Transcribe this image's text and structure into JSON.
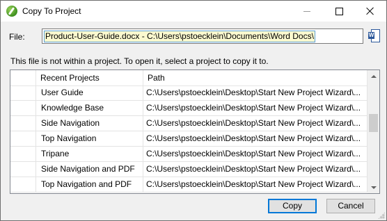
{
  "window": {
    "title": "Copy To Project",
    "controls": {
      "minimize": "minimize",
      "maximize": "maximize",
      "close": "close"
    }
  },
  "file": {
    "label": "File:",
    "value": "Product-User-Guide.docx - C:\\Users\\pstoecklein\\Documents\\Word Docs\\",
    "icon": "word-document-icon"
  },
  "notice": "This file is not within a project. To open it, select a project to copy it to.",
  "table": {
    "columns": [
      "",
      "Recent Projects",
      "Path"
    ],
    "rows": [
      {
        "name": "User Guide",
        "path": "C:\\Users\\pstoecklein\\Desktop\\Start New Project Wizard\\..."
      },
      {
        "name": "Knowledge Base",
        "path": "C:\\Users\\pstoecklein\\Desktop\\Start New Project Wizard\\..."
      },
      {
        "name": "Side Navigation",
        "path": "C:\\Users\\pstoecklein\\Desktop\\Start New Project Wizard\\..."
      },
      {
        "name": "Top Navigation",
        "path": "C:\\Users\\pstoecklein\\Desktop\\Start New Project Wizard\\..."
      },
      {
        "name": "Tripane",
        "path": "C:\\Users\\pstoecklein\\Desktop\\Start New Project Wizard\\..."
      },
      {
        "name": "Side Navigation and PDF",
        "path": "C:\\Users\\pstoecklein\\Desktop\\Start New Project Wizard\\..."
      },
      {
        "name": "Top Navigation and PDF",
        "path": "C:\\Users\\pstoecklein\\Desktop\\Start New Project Wizard\\..."
      }
    ]
  },
  "buttons": {
    "copy": "Copy",
    "cancel": "Cancel"
  },
  "colors": {
    "focus_accent": "#0078d7",
    "field_highlight": "#fbf9cf"
  }
}
